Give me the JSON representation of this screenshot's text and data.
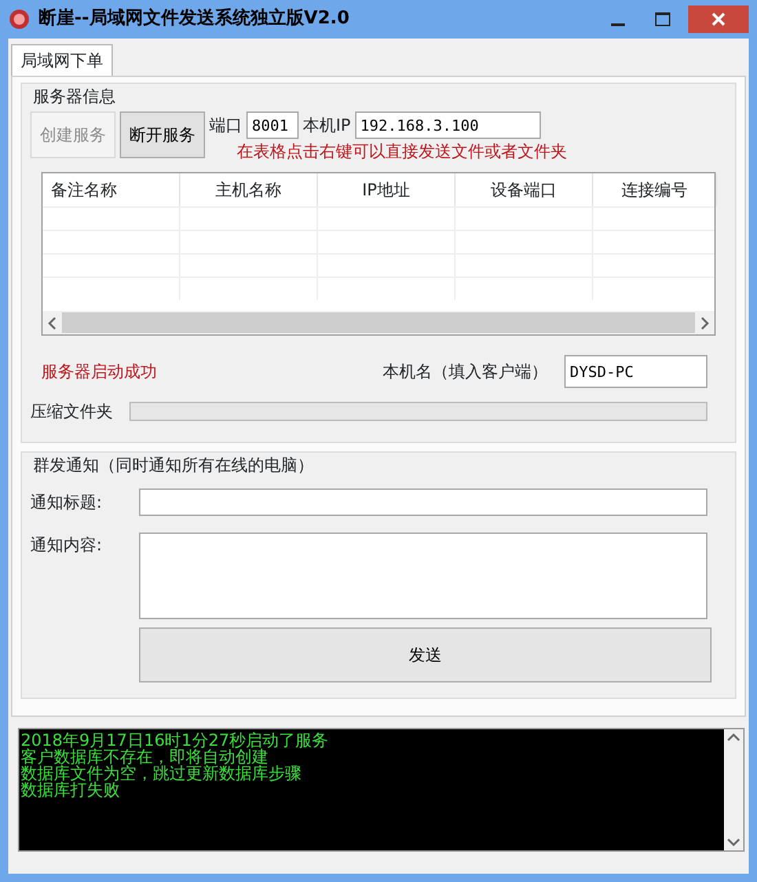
{
  "window": {
    "title": "断崖--局域网文件发送系统独立版V2.0"
  },
  "tabs": [
    {
      "label": "局域网下单",
      "selected": true
    }
  ],
  "server": {
    "title": "服务器信息",
    "buttons": [
      {
        "label": "创建服务",
        "disabled": true
      },
      {
        "label": "断开服务",
        "disabled": false
      }
    ],
    "port": {
      "label": "端口",
      "value": "8001"
    },
    "ip": {
      "label": "本机IP",
      "value": "192.168.3.100"
    },
    "hint": "在表格点击右键可以直接发送文件或者文件夹",
    "table": {
      "columns": [
        "备注名称",
        "主机名称",
        "IP地址",
        "设备端口",
        "连接编号"
      ]
    },
    "status": "服务器启动成功",
    "hostname": {
      "label": "本机名（填入客户端）",
      "value": "DYSD-PC"
    },
    "compress": {
      "label": "压缩文件夹",
      "level": 0
    }
  },
  "notify": {
    "title": "群发通知（同时通知所有在线的电脑）",
    "subject": {
      "label": "通知标题:"
    },
    "content": {
      "label": "通知内容:"
    },
    "send": "发送"
  },
  "log": [
    "2018年9月17日16时1分27秒启动了服务",
    "客户数据库不存在，即将自动创建",
    "数据库文件为空，跳过更新数据库步骤",
    "数据库打失败"
  ]
}
